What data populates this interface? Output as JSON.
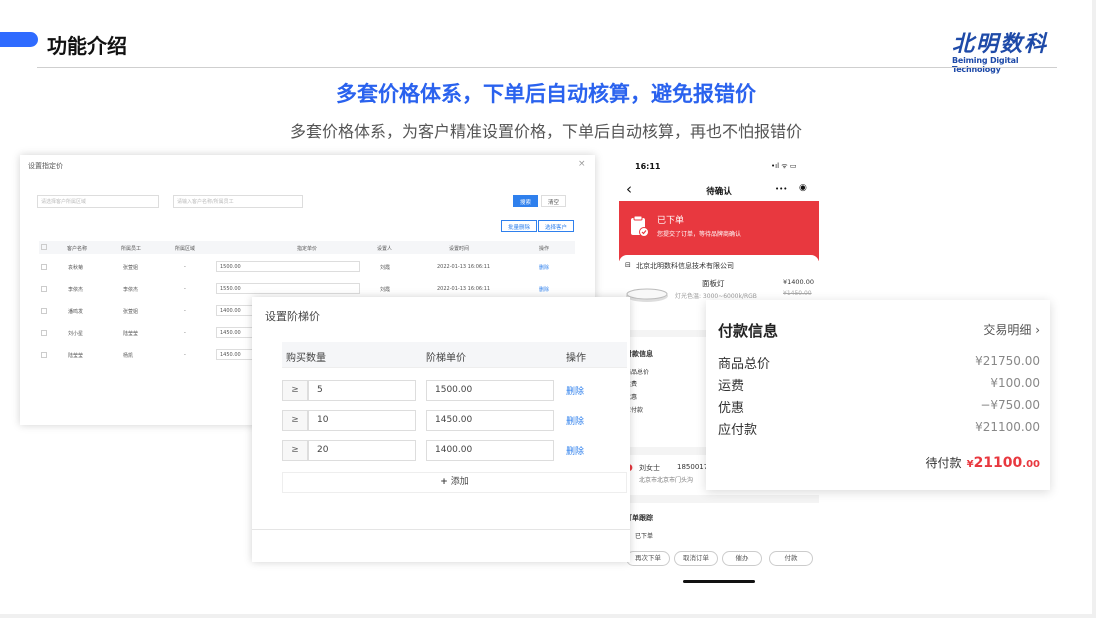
{
  "header": {
    "title": "功能介绍",
    "logo_cn": "北明数科",
    "logo_en": "Beiming Digital Technology"
  },
  "headline": "多套价格体系，下单后自动核算，避免报错价",
  "subheadline": "多套价格体系，为客户精准设置价格，下单后自动核算，再也不怕报错价",
  "colors": {
    "accent": "#2f6bff",
    "headline": "#2a62ee",
    "phone_red": "#e8383f",
    "link": "#2f80ed"
  },
  "panel1": {
    "title": "设置指定价",
    "close": "×",
    "search_customer_placeholder": "请选择客户所属区域",
    "search_staff_placeholder": "请输入客户名称/所属员工",
    "search_btn": "搜索",
    "clear_btn": "清空",
    "batch_delete": "批量删除",
    "select_customer": "选择客户",
    "columns": [
      "客户名称",
      "所属员工",
      "所属区域",
      "指定单价",
      "设置人",
      "设置时间",
      "操作"
    ],
    "rows": [
      {
        "name": "袁秋菊",
        "staff": "张萱姐",
        "region": "-",
        "price": "1500.00",
        "setter": "刘霞",
        "time": "2022-01-13 16:06:11",
        "op": "删除"
      },
      {
        "name": "李依杰",
        "staff": "李依杰",
        "region": "-",
        "price": "1550.00",
        "setter": "刘霞",
        "time": "2022-01-13 16:06:11",
        "op": "删除"
      },
      {
        "name": "潘鸣发",
        "staff": "张萱姐",
        "region": "-",
        "price": "1400.00",
        "setter": "",
        "time": "",
        "op": ""
      },
      {
        "name": "刘小星",
        "staff": "陆莹莹",
        "region": "-",
        "price": "1450.00",
        "setter": "",
        "time": "",
        "op": ""
      },
      {
        "name": "陆莹莹",
        "staff": "杨凯",
        "region": "-",
        "price": "1450.00",
        "setter": "",
        "time": "",
        "op": ""
      }
    ]
  },
  "panel2": {
    "title": "设置阶梯价",
    "col_qty": "购买数量",
    "col_price": "阶梯单价",
    "col_op": "操作",
    "ge": "≥",
    "rows": [
      {
        "qty": "5",
        "price": "1500.00",
        "op": "删除"
      },
      {
        "qty": "10",
        "price": "1450.00",
        "op": "删除"
      },
      {
        "qty": "20",
        "price": "1400.00",
        "op": "删除"
      }
    ],
    "add": "添加",
    "add_icon": "+"
  },
  "phone": {
    "time": "16:11",
    "status_icons": "•ıl ᯤ ▭",
    "back": "‹",
    "nav_title": "待确认",
    "nav_more": "•••",
    "nav_target": "◉",
    "status_title": "已下单",
    "status_desc": "您提交了订单，等待品牌商确认",
    "company": "北京北明数科信息技术有限公司",
    "product_name": "面板灯",
    "product_spec": "灯光色温: 3000~6000k/RGB",
    "product_price": "¥1400.00",
    "product_old_price": "¥1450.00",
    "pay_title": "付款信息",
    "pay_labels": [
      "商品总价",
      "运费",
      "优惠",
      "应付款"
    ],
    "contact_name": "刘女士",
    "contact_phone": "1850017",
    "contact_addr": "北京市北京市门头沟",
    "track_title": "订单跟踪",
    "track_status": "已下单",
    "buttons": [
      "再次下单",
      "取消订单",
      "催办",
      "付款"
    ]
  },
  "payment": {
    "title": "付款信息",
    "detail_link": "交易明细",
    "chevron": "›",
    "items": [
      {
        "label": "商品总价",
        "value": "¥21750.00"
      },
      {
        "label": "运费",
        "value": "¥100.00"
      },
      {
        "label": "优惠",
        "value": "−¥750.00"
      },
      {
        "label": "应付款",
        "value": "¥21100.00"
      }
    ],
    "pending_label": "待付款",
    "pending_currency": "¥",
    "pending_amount": "21100",
    "pending_decimal": ".00"
  }
}
